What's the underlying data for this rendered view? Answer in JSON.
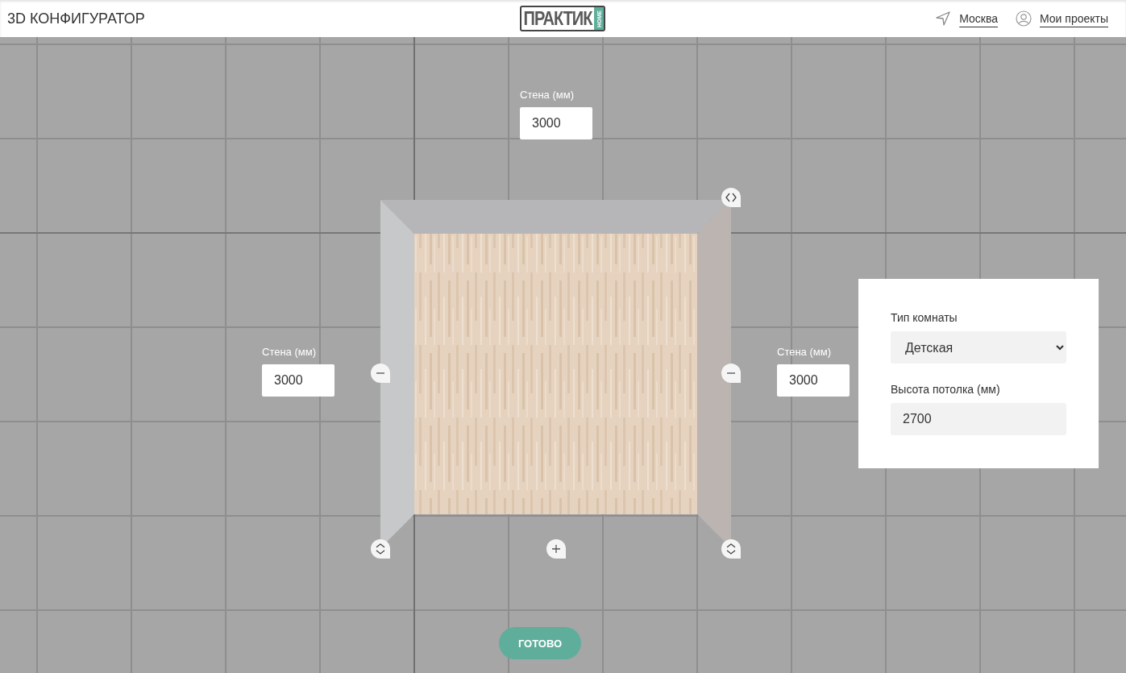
{
  "header": {
    "title": "3D КОНФИГУРАТОР",
    "logo": {
      "name": "ПРАКТИК",
      "badge": "HOME"
    },
    "links": [
      {
        "kind": "location",
        "label": "Москва"
      },
      {
        "kind": "profile",
        "label": "Мои проекты"
      }
    ]
  },
  "walls": [
    {
      "kind": "top",
      "label": "Стена (мм)",
      "value": "3000"
    },
    {
      "kind": "left",
      "label": "Стена (мм)",
      "value": "3000"
    },
    {
      "kind": "right",
      "label": "Стена (мм)",
      "value": "3000"
    }
  ],
  "settings": {
    "room_type": {
      "label": "Тип комнаты",
      "value": "Детская"
    },
    "ceiling_height": {
      "label": "Высота потолка (мм)",
      "value": "2700"
    }
  },
  "done_button": "ГОТОВО"
}
